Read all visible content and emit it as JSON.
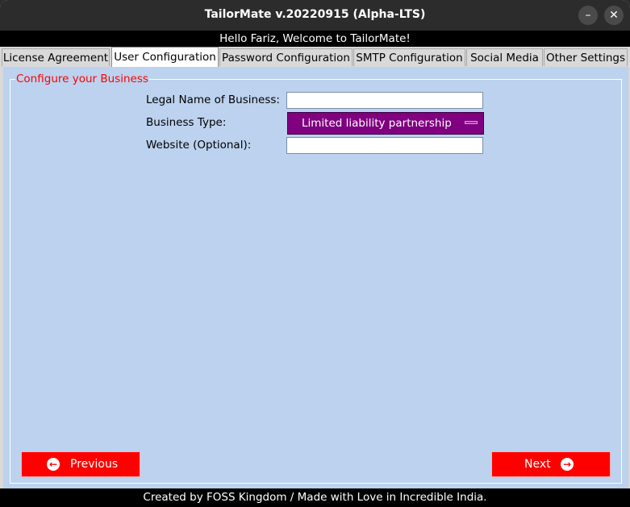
{
  "window": {
    "title": "TailorMate v.20220915 (Alpha-LTS)",
    "minimize_icon": "minimize-icon",
    "close_icon": "close-icon"
  },
  "greeting": "Hello Fariz, Welcome to TailorMate!",
  "tabs": [
    {
      "label": "License Agreement",
      "active": false
    },
    {
      "label": "User Configuration",
      "active": true
    },
    {
      "label": "Password Configuration",
      "active": false
    },
    {
      "label": "SMTP Configuration",
      "active": false
    },
    {
      "label": "Social Media",
      "active": false
    },
    {
      "label": "Other Settings",
      "active": false
    }
  ],
  "section": {
    "title": "Configure your Business",
    "fields": {
      "legal_name": {
        "label": "Legal Name of Business:",
        "value": ""
      },
      "business_type": {
        "label": "Business Type:",
        "value": "Limited liability partnership"
      },
      "website": {
        "label": "Website (Optional):",
        "value": ""
      }
    }
  },
  "navigation": {
    "previous_label": "Previous",
    "next_label": "Next",
    "previous_icon": "arrow-left-circle-icon",
    "next_icon": "arrow-right-circle-icon"
  },
  "footer": "Created by FOSS Kingdom / Made with Love in Incredible India.",
  "colors": {
    "panel": "#bcd2ee",
    "accent_red": "#ff0000",
    "dropdown": "#800080",
    "titlebar": "#2c2c2c"
  }
}
